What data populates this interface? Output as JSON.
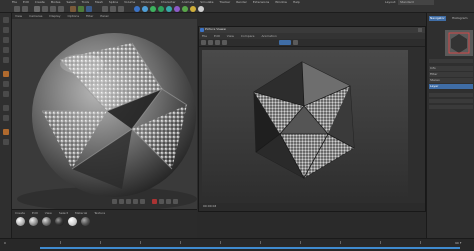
{
  "app": {
    "menu": [
      "File",
      "Edit",
      "Create",
      "Modes",
      "Select",
      "Tools",
      "Mesh",
      "Spline",
      "Volume",
      "MoGraph",
      "Character",
      "Animate",
      "Simulate",
      "Tracker",
      "Render",
      "Extensions",
      "Window",
      "Help"
    ],
    "layout_label": "Layout:",
    "layout_value": "Standard"
  },
  "viewport": {
    "menu": [
      "View",
      "Cameras",
      "Display",
      "Options",
      "Filter",
      "Panel"
    ]
  },
  "material_manager": {
    "menu": [
      "Create",
      "Edit",
      "View",
      "Select",
      "Material",
      "Texture"
    ]
  },
  "picture_viewer": {
    "title": "Picture Viewer",
    "menu": [
      "File",
      "Edit",
      "View",
      "Compare",
      "Animation"
    ],
    "status": "00:00:04"
  },
  "right_panel": {
    "tabs": [
      "Navigator",
      "Histogram"
    ],
    "rows": [
      "Info",
      "Filter",
      "Stereo",
      "Layer"
    ]
  },
  "timeline": {
    "start": "0",
    "end": "90 F"
  },
  "colors": {
    "accent": "#3f8bd0",
    "panel": "#2f2f2f",
    "viewport": "#3a3a3a"
  }
}
